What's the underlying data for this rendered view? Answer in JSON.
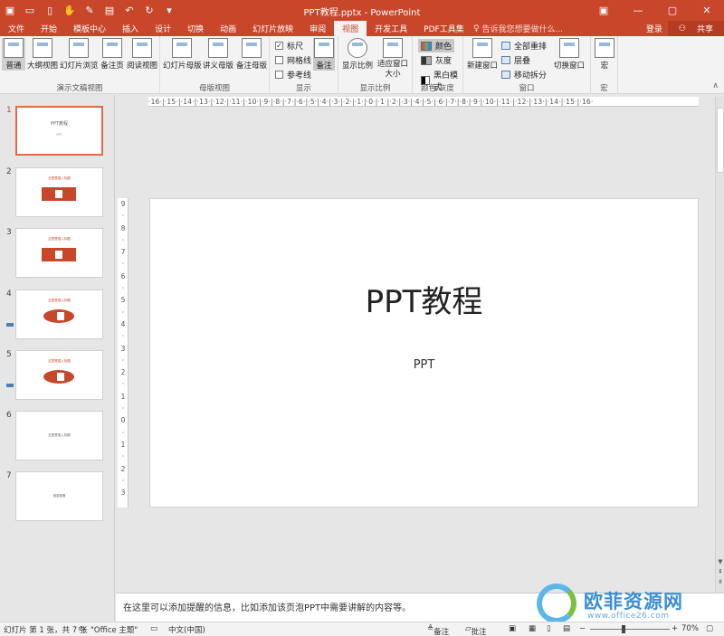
{
  "titlebar": {
    "title": "PPT教程.pptx - PowerPoint",
    "qat_icons": [
      "save-icon",
      "undo-icon",
      "redo-icon"
    ]
  },
  "tabs": [
    "文件",
    "开始",
    "模板中心",
    "插入",
    "设计",
    "切换",
    "动画",
    "幻灯片放映",
    "审阅",
    "视图",
    "开发工具",
    "PDF工具集"
  ],
  "active_tab": "视图",
  "tell_me": "告诉我您想要做什么...",
  "account": {
    "login": "登录",
    "share": "共享"
  },
  "ribbon": {
    "presentation_views": {
      "label": "演示文稿视图",
      "buttons": [
        "普通",
        "大纲视图",
        "幻灯片浏览",
        "备注页",
        "阅读视图"
      ]
    },
    "master_views": {
      "label": "母版视图",
      "buttons": [
        "幻灯片母版",
        "讲义母版",
        "备注母版"
      ]
    },
    "show": {
      "label": "显示",
      "checks": [
        {
          "label": "标尺",
          "checked": true
        },
        {
          "label": "网格线",
          "checked": false
        },
        {
          "label": "参考线",
          "checked": false
        }
      ],
      "notes_button": "备注"
    },
    "zoom": {
      "label": "显示比例",
      "buttons": [
        "显示比例",
        "适应窗口大小"
      ]
    },
    "color": {
      "label": "颜色/灰度",
      "options": [
        "颜色",
        "灰度",
        "黑白模式"
      ]
    },
    "window": {
      "label": "窗口",
      "new_window": "新建窗口",
      "small": [
        "全部重排",
        "层叠",
        "移动拆分"
      ],
      "switch": "切换窗口"
    },
    "macro": {
      "label": "宏",
      "button": "宏"
    }
  },
  "thumbnails": [
    {
      "num": "1",
      "title": "PPT教程",
      "sub": "PPT"
    },
    {
      "num": "2",
      "title": "这里是插入标题"
    },
    {
      "num": "3",
      "title": "这里是插入标题"
    },
    {
      "num": "4",
      "title": "这里是插入标题"
    },
    {
      "num": "5",
      "title": "这里是插入标题"
    },
    {
      "num": "6",
      "title": "这里是插入标题"
    },
    {
      "num": "7",
      "title": "谢谢观看"
    }
  ],
  "ruler": {
    "horizontal": "·16·|·15·|·14·|·13·|·12·|·11·|·10·|·9·|·8·|·7·|·6·|·5·|·4·|·3·|·2·|·1·|·0·|·1·|·2·|·3·|·4·|·5·|·6·|·7·|·8·|·9·|·10·|·11·|·12·|·13·|·14·|·15·|·16·",
    "vertical": [
      "9",
      "·",
      "8",
      "·",
      "7",
      "·",
      "6",
      "·",
      "5",
      "·",
      "4",
      "·",
      "3",
      "·",
      "2",
      "·",
      "1",
      "·",
      "0",
      "·",
      "1",
      "·",
      "2",
      "·",
      "3"
    ]
  },
  "slide": {
    "title": "PPT教程",
    "subtitle": "PPT"
  },
  "notes": "在这里可以添加提醒的信息，比如添加该页泡PPT中需要讲解的内容等。",
  "watermark": {
    "name": "欧菲资源网",
    "url": "www.office26.com"
  },
  "status": {
    "slide_info": "幻灯片 第 1 张，共 7 张",
    "theme": "\"Office 主题\"",
    "language": "中文(中国)",
    "notes": "备注",
    "comments": "批注",
    "zoom": "70%"
  }
}
